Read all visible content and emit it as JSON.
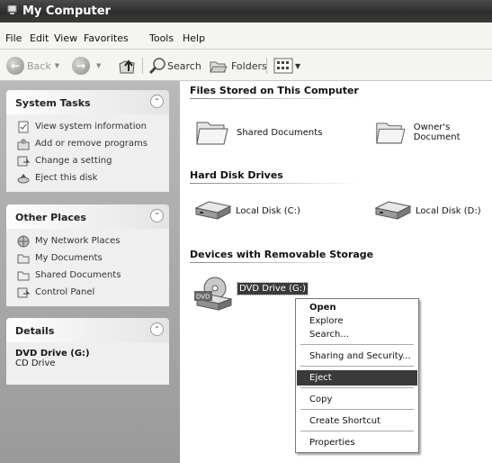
{
  "window": {
    "title": "My Computer"
  },
  "menubar": {
    "items": [
      "File",
      "Edit",
      "View",
      "Favorites",
      "Tools",
      "Help"
    ]
  },
  "toolbar": {
    "back": "Back",
    "search": "Search",
    "folders": "Folders"
  },
  "left": {
    "system_tasks": {
      "title": "System Tasks",
      "items": [
        "View system information",
        "Add or remove programs",
        "Change a setting",
        "Eject this disk"
      ]
    },
    "other_places": {
      "title": "Other Places",
      "items": [
        "My Network Places",
        "My Documents",
        "Shared Documents",
        "Control Panel"
      ]
    },
    "details": {
      "title": "Details",
      "name": "DVD Drive (G:)",
      "type": "CD Drive"
    }
  },
  "content": {
    "groups": {
      "files": "Files Stored on This Computer",
      "hard_disks": "Hard Disk Drives",
      "removable": "Devices with Removable Storage"
    },
    "items": {
      "shared_documents": "Shared Documents",
      "owners_documents": "Owner's Document",
      "local_c": "Local Disk (C:)",
      "local_d": "Local Disk (D:)",
      "dvd": "DVD Drive (G:)",
      "dvd_badge": "DVD"
    }
  },
  "context_menu": {
    "open": "Open",
    "explore": "Explore",
    "search": "Search...",
    "sharing": "Sharing and Security...",
    "eject": "Eject",
    "copy": "Copy",
    "create_shortcut": "Create Shortcut",
    "properties": "Properties"
  },
  "icons": [
    "computer-icon",
    "back-icon",
    "forward-icon",
    "up-folder-icon",
    "search-icon",
    "folders-icon",
    "views-icon",
    "collapse-icon",
    "folder-icon",
    "hard-disk-icon",
    "dvd-drive-icon"
  ]
}
